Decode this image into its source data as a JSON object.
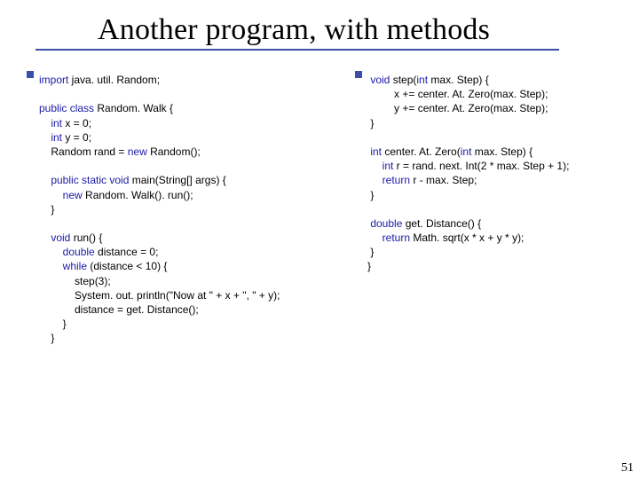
{
  "title": "Another program, with methods",
  "page_number": "51",
  "left_code": {
    "l01a": "import",
    "l01b": " java. util. Random;",
    "l02a": "public",
    "l02b": " class",
    "l02c": " Random. Walk {",
    "l03a": "    int",
    "l03b": " x = 0;",
    "l04a": "    int",
    "l04b": " y = 0;",
    "l05a": "    Random rand = ",
    "l05b": "new",
    "l05c": " Random();",
    "l06a": "    public",
    "l06b": " static",
    "l06c": " void",
    "l06d": " main(String[] args) {",
    "l07a": "        new",
    "l07b": " Random. Walk(). run();",
    "l08": "    }",
    "l09a": "    void",
    "l09b": " run() {",
    "l10a": "        double",
    "l10b": " distance = 0;",
    "l11a": "        while",
    "l11b": " (distance < 10) {",
    "l12": "            step(3);",
    "l13": "            System. out. println(\"Now at \" + x + \", \" + y);",
    "l14": "            distance = get. Distance();",
    "l15": "        }",
    "l16": "    }"
  },
  "right_code": {
    "r01a": " void",
    "r01b": " step(",
    "r01c": "int",
    "r01d": " max. Step) {",
    "r02": "         x += center. At. Zero(max. Step);",
    "r03": "         y += center. At. Zero(max. Step);",
    "r04": " }",
    "r05a": " int",
    "r05b": " center. At. Zero(",
    "r05c": "int",
    "r05d": " max. Step) {",
    "r06a": "     int",
    "r06b": " r = rand. next. Int(2 * max. Step + 1);",
    "r07a": "     return",
    "r07b": " r - max. Step;",
    "r08": " }",
    "r09a": " double",
    "r09b": " get. Distance() {",
    "r10a": "     return",
    "r10b": " Math. sqrt(x * x + y * y);",
    "r11": " }",
    "r12": "}"
  }
}
